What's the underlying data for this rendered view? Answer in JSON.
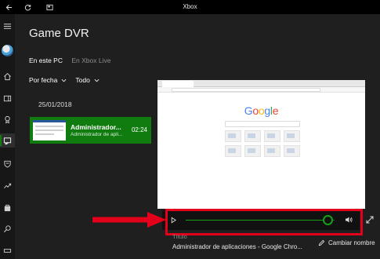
{
  "window": {
    "title": "Xbox"
  },
  "nav": {
    "items": [
      "menu",
      "avatar",
      "home",
      "my-collection",
      "achievements",
      "game-dvr",
      "clubs",
      "trending",
      "store",
      "search",
      "settings"
    ]
  },
  "page": {
    "title": "Game DVR",
    "source_tabs": [
      {
        "label": "En este PC",
        "active": true
      },
      {
        "label": "En Xbox Live",
        "active": false
      }
    ],
    "filters": {
      "sort_label": "Por fecha",
      "type_label": "Todo"
    },
    "date_header": "25/01/2018",
    "clip": {
      "title": "Administrador...",
      "subtitle": "Administrador de apli...",
      "duration": "02:24"
    }
  },
  "preview": {
    "logo_letters": [
      "G",
      "o",
      "o",
      "g",
      "l",
      "e"
    ]
  },
  "player": {
    "progress": 0.95
  },
  "details": {
    "label": "Título",
    "title": "Administrador de aplicaciones - Google Chro...",
    "rename_label": "Cambiar nombre"
  },
  "colors": {
    "accent": "#107c10",
    "annotation": "#e3001b",
    "background": "#1f1f1f"
  }
}
